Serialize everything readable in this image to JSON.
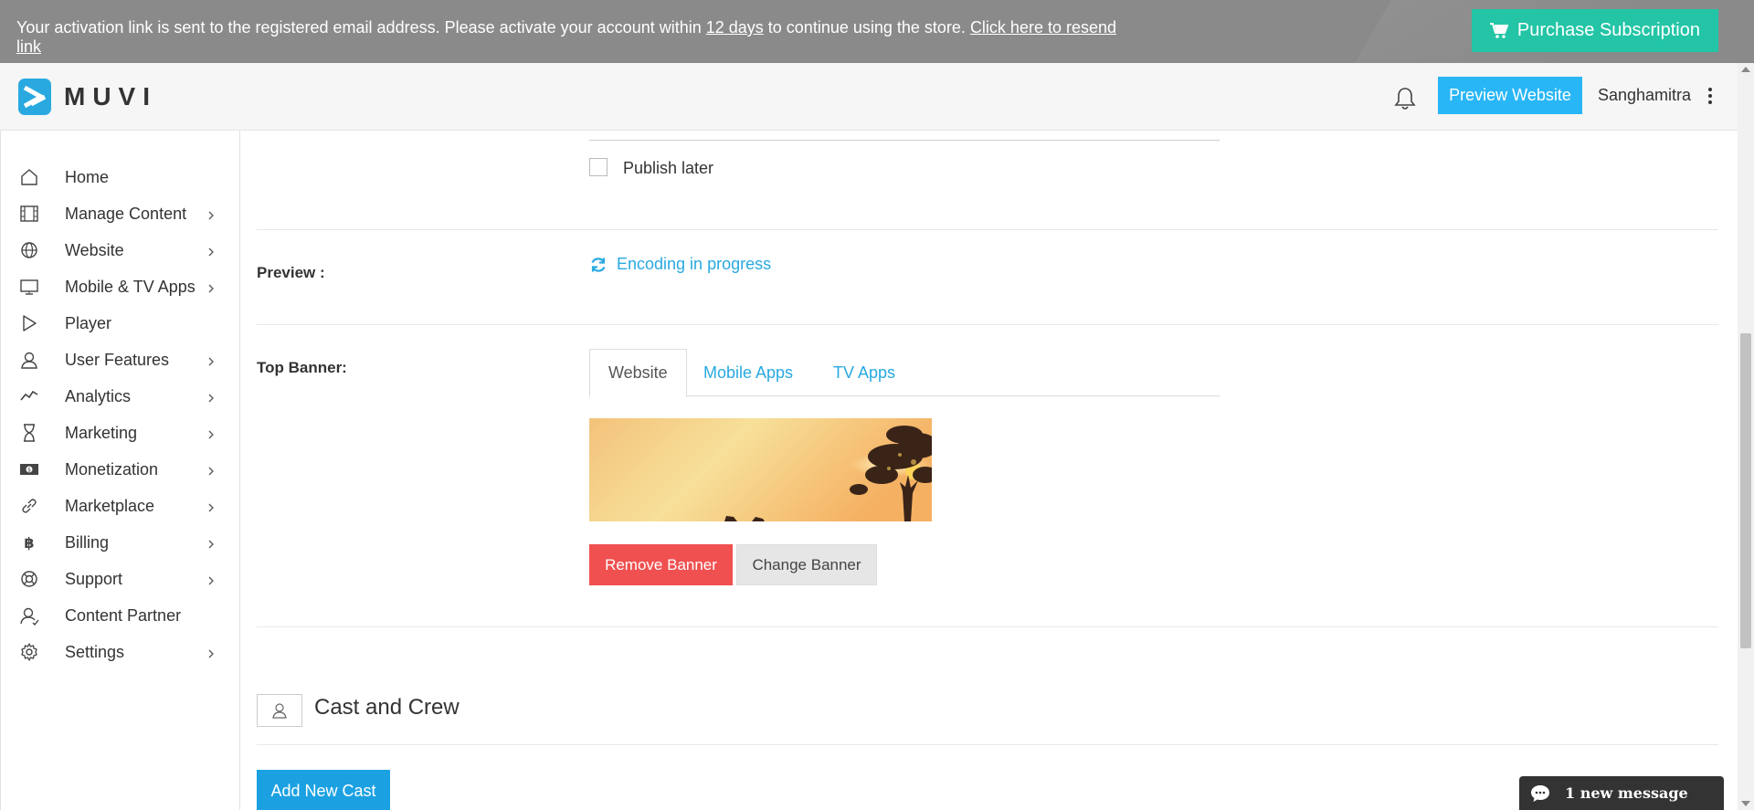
{
  "activation": {
    "text_before": "Your activation link is sent to the registered email address. Please activate your account within ",
    "days_link": "12 days",
    "text_after": " to continue using the store. ",
    "resend_link": "Click here to resend link",
    "purchase_label": "Purchase Subscription"
  },
  "header": {
    "logo_text": "MUVI",
    "preview_label": "Preview Website",
    "user_name": "Sanghamitra"
  },
  "sidebar": {
    "items": [
      {
        "label": "Home",
        "icon": "home-icon",
        "has_children": false
      },
      {
        "label": "Manage Content",
        "icon": "film-icon",
        "has_children": true
      },
      {
        "label": "Website",
        "icon": "globe-icon",
        "has_children": true
      },
      {
        "label": "Mobile & TV Apps",
        "icon": "monitor-icon",
        "has_children": true
      },
      {
        "label": "Player",
        "icon": "play-icon",
        "has_children": false
      },
      {
        "label": "User Features",
        "icon": "user-icon",
        "has_children": true
      },
      {
        "label": "Analytics",
        "icon": "analytics-icon",
        "has_children": true
      },
      {
        "label": "Marketing",
        "icon": "hourglass-icon",
        "has_children": true
      },
      {
        "label": "Monetization",
        "icon": "money-icon",
        "has_children": true
      },
      {
        "label": "Marketplace",
        "icon": "link-icon",
        "has_children": true
      },
      {
        "label": "Billing",
        "icon": "bitcoin-icon",
        "has_children": true
      },
      {
        "label": "Support",
        "icon": "lifebuoy-icon",
        "has_children": true
      },
      {
        "label": "Content Partner",
        "icon": "partner-icon",
        "has_children": false
      },
      {
        "label": "Settings",
        "icon": "gear-icon",
        "has_children": true
      }
    ]
  },
  "form": {
    "publish_later_label": "Publish later",
    "preview_label": "Preview :",
    "encoding_status": "Encoding in progress",
    "top_banner_label": "Top Banner:",
    "tabs": [
      {
        "label": "Website",
        "active": true
      },
      {
        "label": "Mobile Apps",
        "active": false
      },
      {
        "label": "TV Apps",
        "active": false
      }
    ],
    "remove_banner_label": "Remove Banner",
    "change_banner_label": "Change Banner"
  },
  "cast": {
    "title": "Cast and Crew",
    "add_label": "Add New Cast"
  },
  "chat": {
    "label": "1 new message"
  },
  "colors": {
    "accent": "#29b6f6",
    "purchase": "#23c5a6",
    "remove": "#f05050",
    "link": "#29a9e0"
  }
}
